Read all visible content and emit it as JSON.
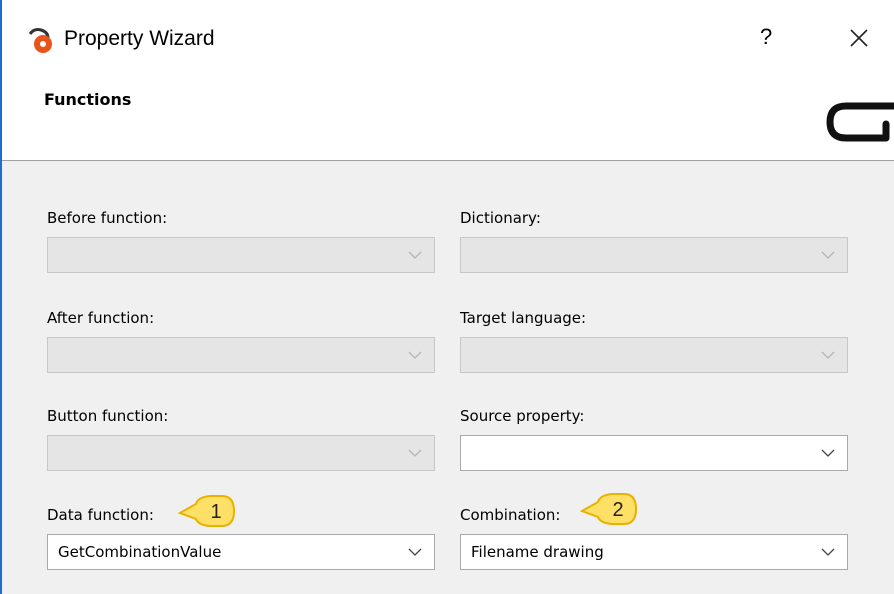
{
  "window": {
    "title": "Property Wizard",
    "help_label": "?"
  },
  "header": {
    "section_title": "Functions"
  },
  "fields": {
    "before_function": {
      "label": "Before function:",
      "value": ""
    },
    "dictionary": {
      "label": "Dictionary:",
      "value": ""
    },
    "after_function": {
      "label": "After function:",
      "value": ""
    },
    "target_language": {
      "label": "Target language:",
      "value": ""
    },
    "button_function": {
      "label": "Button function:",
      "value": ""
    },
    "source_property": {
      "label": "Source property:",
      "value": ""
    },
    "data_function": {
      "label": "Data function:",
      "value": "GetCombinationValue"
    },
    "combination": {
      "label": "Combination:",
      "value": "Filename drawing"
    }
  },
  "callouts": [
    {
      "number": "1"
    },
    {
      "number": "2"
    }
  ],
  "colors": {
    "accent_edge": "#1c6fd0",
    "callout_fill": "#ffe066",
    "callout_stroke": "#e8b200",
    "panel_bg": "#f0f0f0",
    "disabled_combo": "#e5e5e5"
  },
  "icons": [
    "app-icon",
    "help-icon",
    "close-icon",
    "chevron-down-icon",
    "brand-logo"
  ]
}
